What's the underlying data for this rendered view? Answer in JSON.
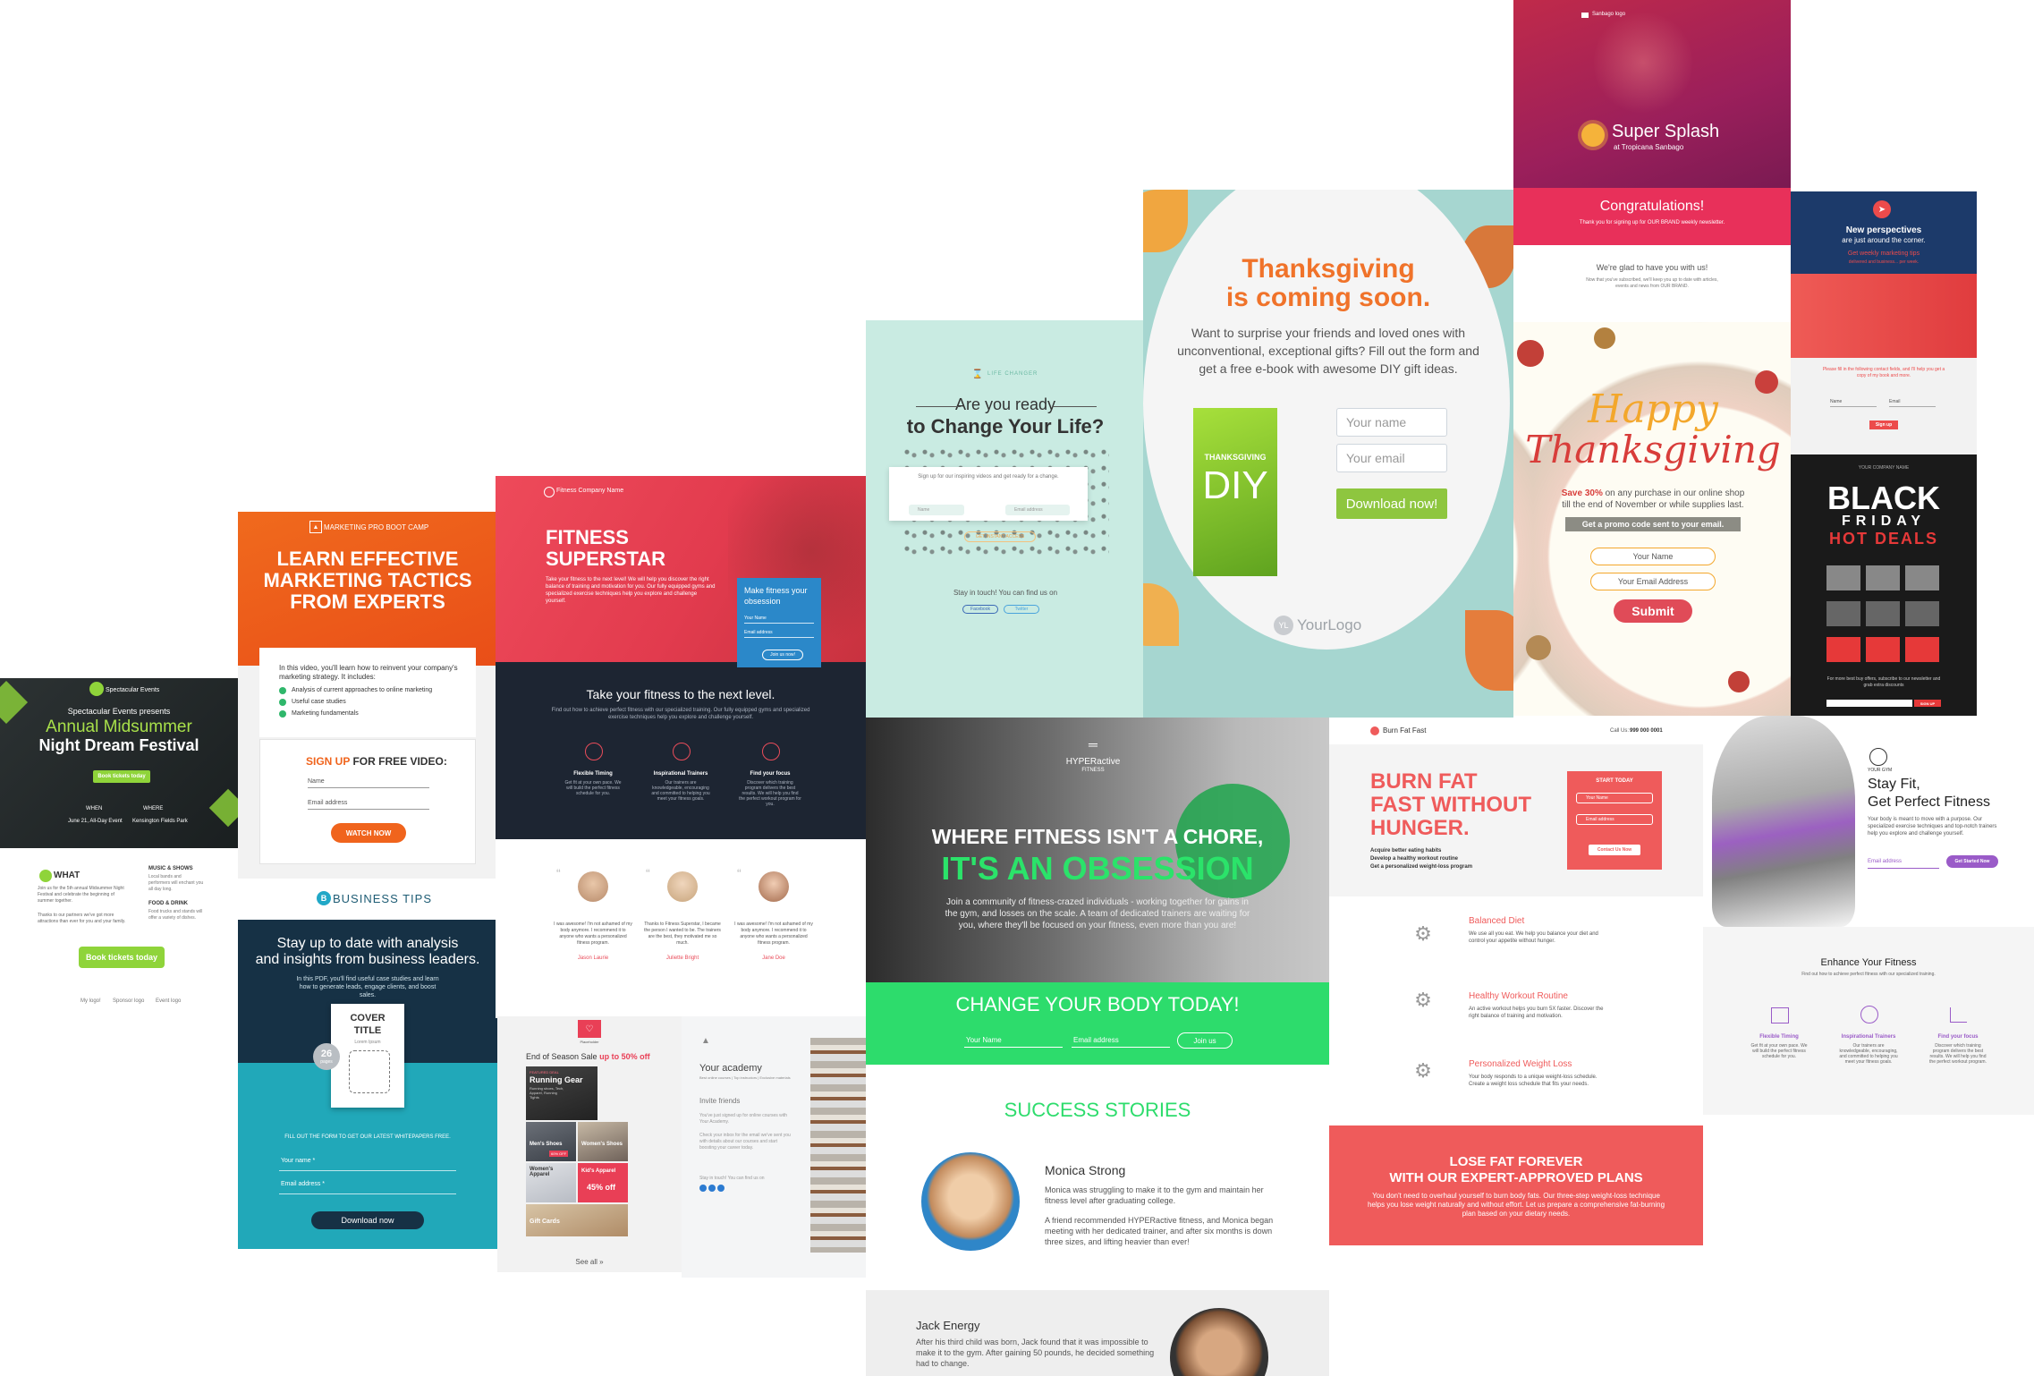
{
  "festival": {
    "brand": "Spectacular Events",
    "presents": "Spectacular Events presents",
    "title1": "Annual Midsummer",
    "title2": "Night Dream Festival",
    "cta": "Book tickets today",
    "when_label": "WHEN",
    "when_value": "June 21, All-Day Event",
    "where_label": "WHERE",
    "where_value": "Kensington Fields Park",
    "what": "WHAT",
    "what_text": "Join us for the 5th annual Midsummer Night Festival and celebrate the beginning of summer together.",
    "what_text2": "Thanks to our partners we've got more attractions than ever for you and your family.",
    "music": "MUSIC & SHOWS",
    "music_text": "Local bands and performers will enchant you all day long.",
    "food": "FOOD & DRINK",
    "food_text": "Food trucks and stands will offer a variety of dishes.",
    "cta2": "Book tickets today",
    "logo1": "My logo!",
    "logo2": "Sponsor logo",
    "logo3": "Event logo"
  },
  "marketing": {
    "brand": "MARKETING PRO BOOT CAMP",
    "h1": "LEARN EFFECTIVE",
    "h2": "MARKETING TACTICS",
    "h3": "FROM EXPERTS",
    "intro": "In this video, you'll learn how to reinvent your company's marketing strategy. It includes:",
    "b1": "Analysis of current approaches to online marketing",
    "b2": "Useful case studies",
    "b3": "Marketing fundamentals",
    "signup": "SIGN UP",
    "signup2": "FOR FREE VIDEO:",
    "name": "Name",
    "email": "Email address",
    "cta": "WATCH NOW"
  },
  "business": {
    "logo": "BUSINESS TIPS",
    "h1": "Stay up to date with analysis",
    "h2": "and insights from business leaders.",
    "sub": "In this PDF, you'll find useful case studies and learn how to generate leads, engage clients, and boost sales.",
    "cover1": "COVER",
    "cover2": "TITLE",
    "cover_sub": "Lorem Ipsum",
    "pages": "26",
    "pages_label": "pages",
    "form_title": "FILL OUT THE FORM TO GET OUR LATEST WHITEPAPERS FREE.",
    "name": "Your name *",
    "email": "Email address *",
    "cta": "Download now"
  },
  "fitness": {
    "brand": "Fitness Company Name",
    "h1": "FITNESS",
    "h2": "SUPERSTAR",
    "text": "Take your fitness to the next level! We will help you discover the right balance of training and motivation for you. Our fully equipped gyms and specialized exercise techniques help you explore and challenge yourself.",
    "form_title": "Make fitness your obsession",
    "name": "Your Name",
    "email": "Email address",
    "cta": "Join us now!",
    "sub": "Take your fitness to the next level.",
    "sub_text": "Find out how to achieve perfect fitness with our specialized training. Our fully equipped gyms and specialized exercise techniques help you explore and challenge yourself.",
    "f1": "Flexible Timing",
    "f1_text": "Get fit at your own pace. We will build the perfect fitness schedule for you.",
    "f2": "Inspirational Trainers",
    "f2_text": "Our trainers are knowledgeable, encouraging and committed to helping you meet your fitness goals.",
    "f3": "Find your focus",
    "f3_text": "Discover which training program delivers the best results. We will help you find the perfect workout program for you."
  },
  "testimonials": {
    "t1": "I was awesome! I'm not ashamed of my body anymore. I recommend it to anyone who wants a personalized fitness program.",
    "n1": "Jason Laurie",
    "t2": "Thanks to Fitness Superstar, I became the person I wanted to be. The trainers are the best, they motivated me so much.",
    "n2": "Juliette Bright",
    "t3": "I was awesome! I'm not ashamed of my body anymore. I recommend it to anyone who wants a personalized fitness program.",
    "n3": "Jane Doe"
  },
  "sale": {
    "logo": "Placeholder",
    "title": "End of Season Sale",
    "title2": "up to 50% off",
    "running_tag": "FEATURED DEAL",
    "running": "Running Gear",
    "running_sub": "Running shoes, Tech, Apparel, Running Tights",
    "mens": "Men's Shoes",
    "mens_off": "60% OFF",
    "womens_shoes": "Women's Shoes",
    "womens_apparel": "Women's Apparel",
    "kids": "Kid's Apparel",
    "kids_off": "45% off",
    "gift": "Gift Cards",
    "see_all": "See all »"
  },
  "academy": {
    "title": "Your academy",
    "sub": "Best online courses | Top instructors | Exclusive materials",
    "invite": "Invite friends",
    "invite_text": "You've just signed up for online courses with Your Academy.",
    "invite_text2": "Check your inbox for the email we've sent you with details about our courses and start boosting your career today.",
    "touch": "Stay in touch! You can find us on"
  },
  "change": {
    "brand": "LIFE CHANGER",
    "h1": "Are you ready",
    "h2": "to Change Your Life?",
    "sub": "Sign up for our inspiring videos and get ready for a change.",
    "name": "Name",
    "email": "Email address",
    "cta": "GET INSTANT ACCESS",
    "touch": "Stay in touch! You can find us on",
    "fb": "Facebook",
    "tw": "Twitter"
  },
  "thanks": {
    "h1": "Thanksgiving",
    "h2": "is coming soon.",
    "p1": "Want to surprise your friends and loved ones with",
    "p2": "unconventional, exceptional gifts? Fill out the form and",
    "p3": "get a free e-book with awesome DIY gift ideas.",
    "book1": "THANKSGIVING",
    "book2": "DIY",
    "name": "Your name",
    "email": "Your email",
    "cta": "Download now!",
    "logo": "YourLogo"
  },
  "hyper": {
    "brand": "HYPERactive",
    "brand2": "FITNESS",
    "h1": "WHERE FITNESS ISN'T A CHORE,",
    "h2": "IT'S AN OBSESSION",
    "text": "Join a community of fitness-crazed individuals - working together for gains in the gym, and losses on the scale. A team of dedicated trainers are waiting for you, where they'll be focused on your fitness, even more than you are!",
    "band": "CHANGE YOUR BODY TODAY!",
    "name": "Your Name",
    "email": "Email address",
    "cta": "Join us",
    "success": "SUCCESS STORIES",
    "s1_name": "Monica Strong",
    "s1_text": "Monica was struggling to make it to the gym and maintain her fitness level after graduating college.",
    "s1_text2": "A friend recommended HYPERactive fitness, and Monica began meeting with her dedicated trainer, and after six months is down three sizes, and lifting heavier than ever!",
    "s2_name": "Jack Energy",
    "s2_text": "After his third child was born, Jack found that it was impossible to make it to the gym. After gaining 50 pounds, he decided something had to change."
  },
  "splash": {
    "logo": "Sanbago logo",
    "title": "Super Splash",
    "sub": "at Tropicana Sanbago",
    "congrats": "Congratulations!",
    "thanks_text": "Thank you for signing up for OUR BRAND weekly newsletter.",
    "glad": "We're glad to have you with us!",
    "glad_text": "Now that you've subscribed, we'll keep you up to date with articles, events and news from OUR BRAND."
  },
  "happy": {
    "h1": "Happy",
    "h2": "Thanksgiving",
    "p1": "Save 30%",
    "p1b": "on any purchase in our online shop",
    "p2": "till the end of November or while supplies last.",
    "band": "Get a promo code sent to your email.",
    "name": "Your Name",
    "email": "Your Email Address",
    "cta": "Submit"
  },
  "perspectives": {
    "h1": "New perspectives",
    "h2": "are just around the corner.",
    "sub": "Get weekly marketing tips",
    "sub2": "delivered and business... per week.",
    "form_text": "Please fill in the following contact fields, and I'll help you get a copy of my book and more.",
    "name": "Name",
    "email": "Email",
    "cta": "Sign up"
  },
  "blackfriday": {
    "brand": "YOUR COMPANY NAME",
    "h1": "BLACK",
    "h2": "FRIDAY",
    "h3": "HOT DEALS",
    "text": "For more best buy offers, subscribe to our newsletter and grab extra discounts",
    "cta": "SIGN UP"
  },
  "burn": {
    "logo": "Burn Fat Fast",
    "call": "Call Us:",
    "phone": "999 000 0001",
    "h1": "BURN FAT",
    "h2": "FAST WITHOUT",
    "h3": "HUNGER.",
    "b1": "Acquire better eating habits",
    "b2": "Develop a healthy workout routine",
    "b3": "Get a personalized weight-loss program",
    "start": "START TODAY",
    "name": "Your Name",
    "email": "Email address",
    "cta": "Contact Us Now",
    "f1": "Balanced Diet",
    "f1_text": "We use all you eat. We help you balance your diet and control your appetite without hunger.",
    "f2": "Healthy Workout Routine",
    "f2_text": "An active workout helps you burn 5X faster. Discover the right balance of training and motivation.",
    "f3": "Personalized Weight Loss",
    "f3_text": "Your body responds to a unique weight-loss schedule. Create a weight loss schedule that fits your needs.",
    "lose1": "LOSE FAT FOREVER",
    "lose2": "WITH OUR EXPERT-APPROVED PLANS",
    "lose_text": "You don't need to overhaul yourself to burn body fats. Our three-step weight-loss technique helps you lose weight naturally and without effort. Let us prepare a comprehensive fat-burning plan based on your dietary needs."
  },
  "gym": {
    "logo": "YOUR GYM",
    "h1": "Stay Fit,",
    "h2": "Get Perfect Fitness",
    "text": "Your body is meant to move with a purpose. Our specialized exercise techniques and top-notch trainers help you explore and challenge yourself.",
    "email": "Email address",
    "cta": "Get Started Now",
    "enhance": "Enhance Your Fitness",
    "enhance_text": "Find out how to achieve perfect fitness with our specialized training.",
    "f1": "Flexible Timing",
    "f1_text": "Get fit at your own pace. We will build the perfect fitness schedule for you.",
    "f2": "Inspirational Trainers",
    "f2_text": "Our trainers are knowledgeable, encouraging, and committed to helping you meet your fitness goals.",
    "f3": "Find your focus",
    "f3_text": "Discover which training program delivers the best results. We will help you find the perfect workout program."
  }
}
